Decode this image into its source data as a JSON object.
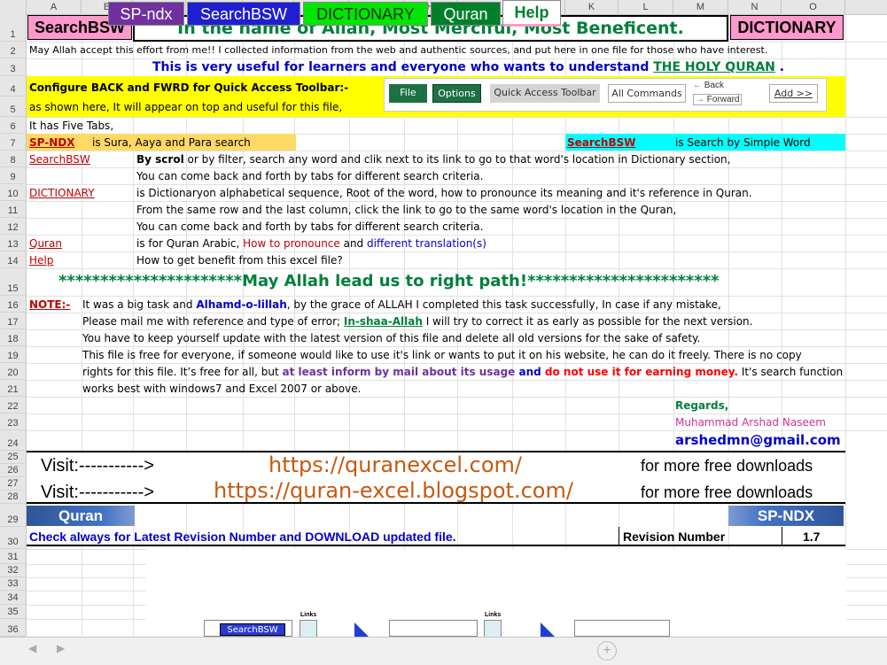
{
  "columns": [
    "A",
    "B",
    "C",
    "D",
    "E",
    "F",
    "G",
    "H",
    "I",
    "J",
    "K",
    "L",
    "M",
    "N",
    "O"
  ],
  "rows": [
    "1",
    "2",
    "3",
    "4",
    "5",
    "6",
    "7",
    "8",
    "9",
    "10",
    "11",
    "12",
    "13",
    "14",
    "15",
    "16",
    "17",
    "18",
    "19",
    "20",
    "21",
    "22",
    "23",
    "24",
    "25",
    "26",
    "27",
    "28",
    "29",
    "30",
    "31",
    "32",
    "33",
    "34",
    "35",
    "36"
  ],
  "r1": {
    "left": "SearchBSW",
    "title": "In the name of Allah, Most Merciful, Most Beneficent.",
    "right": "DICTIONARY"
  },
  "r2": "May Allah accept this effort from me!!  I collected information from the web and authentic sources, and put here in one file for those who have interest.",
  "r3": {
    "text": "This is very useful for learners and everyone who wants to understand ",
    "link": "THE HOLY QURAN",
    "end": " ."
  },
  "r4": "Configure BACK and FWRD for Quick Access Toolbar:-",
  "r5": "as shown here, It will appear on top and useful for this file,",
  "toolbar": {
    "file": "File",
    "options": "Options",
    "qat": "Quick Access Toolbar",
    "all": "All Commands",
    "back": "Back",
    "forward": "Forward",
    "add": "Add >>"
  },
  "r6": "It has Five Tabs,",
  "r7": {
    "link1": "SP-NDX",
    "text1": "is Sura, Aaya and Para search",
    "link2": "SearchBSW",
    "text2": "is Search by Simple Word"
  },
  "r8": {
    "link": "SearchBSW",
    "bold": "By scrol",
    "text": " or by filter, search any word and clik next to its link to go to that word's location in Dictionary section,"
  },
  "r9": "You can come back and forth by tabs for different search criteria.",
  "r10": {
    "link": "DICTIONARY",
    "text": "is Dictionaryon alphabetical sequence, Root of the word, how to pronounce its  meaning and it's reference in Quran."
  },
  "r11": "From the same row and the last column, click the link to go to the same word's location in the Quran,",
  "r12": "You can come back and forth by tabs for different search criteria.",
  "r13": {
    "link": "Quran",
    "text1": "is for Quran Arabic, ",
    "red": "How to pronounce",
    "text2": " and  ",
    "blue": "different translation(s)"
  },
  "r14": {
    "link": "Help",
    "text": "How to get benefit from this excel file?"
  },
  "r15": "**********************May Allah lead us to right path!***********************",
  "r16": {
    "link": "NOTE:-",
    "t1": "It was a big task and ",
    "b1": "Alhamd-o-lillah",
    "t2": ", by the grace of ALLAH I completed this task successfully, In case if any mistake,"
  },
  "r17": {
    "t1": "Please mail me with reference and type of error; ",
    "g": "In-shaa-Allah",
    "t2": " I will try to correct it as early as possible for the next version."
  },
  "r18": "You have to keep yourself update with the latest version of this file and delete all old versions for the sake of safety.",
  "r19": "This file is free for everyone, if someone would like to use it's link or wants to put it on his website, he can do it freely. There is no copy",
  "r20": {
    "t1": "rights for this file. It’s free for all, but ",
    "p": "at least inform by mail about its usage",
    "t2": " and ",
    "b": "do not use it for earning money.",
    "t3": "  It's search function"
  },
  "r21": "works best with windows7 and Excel 2007 or above.",
  "regards": "Regards,",
  "author": "Muhammad Arshad Naseem",
  "email": "arshedmn@gmail.com",
  "visit1": {
    "label": "Visit:----------->",
    "url": "https://quranexcel.com/",
    "more": "for more free downloads"
  },
  "visit2": {
    "label": "Visit:----------->",
    "url": "https://quran-excel.blogspot.com/",
    "more": "for more free downloads"
  },
  "r29": {
    "left": "Quran",
    "right": "SP-NDX"
  },
  "r30": {
    "text": "Check always for Latest Revision Number and DOWNLOAD updated file.",
    "label": "Revision Number",
    "value": "1.7"
  },
  "mini": {
    "search": "SearchBSW",
    "links1": "Links",
    "links2": "Links"
  },
  "tabs": [
    "SP-ndx",
    "SearchBSW",
    "DICTIONARY",
    "Quran",
    "Help"
  ]
}
